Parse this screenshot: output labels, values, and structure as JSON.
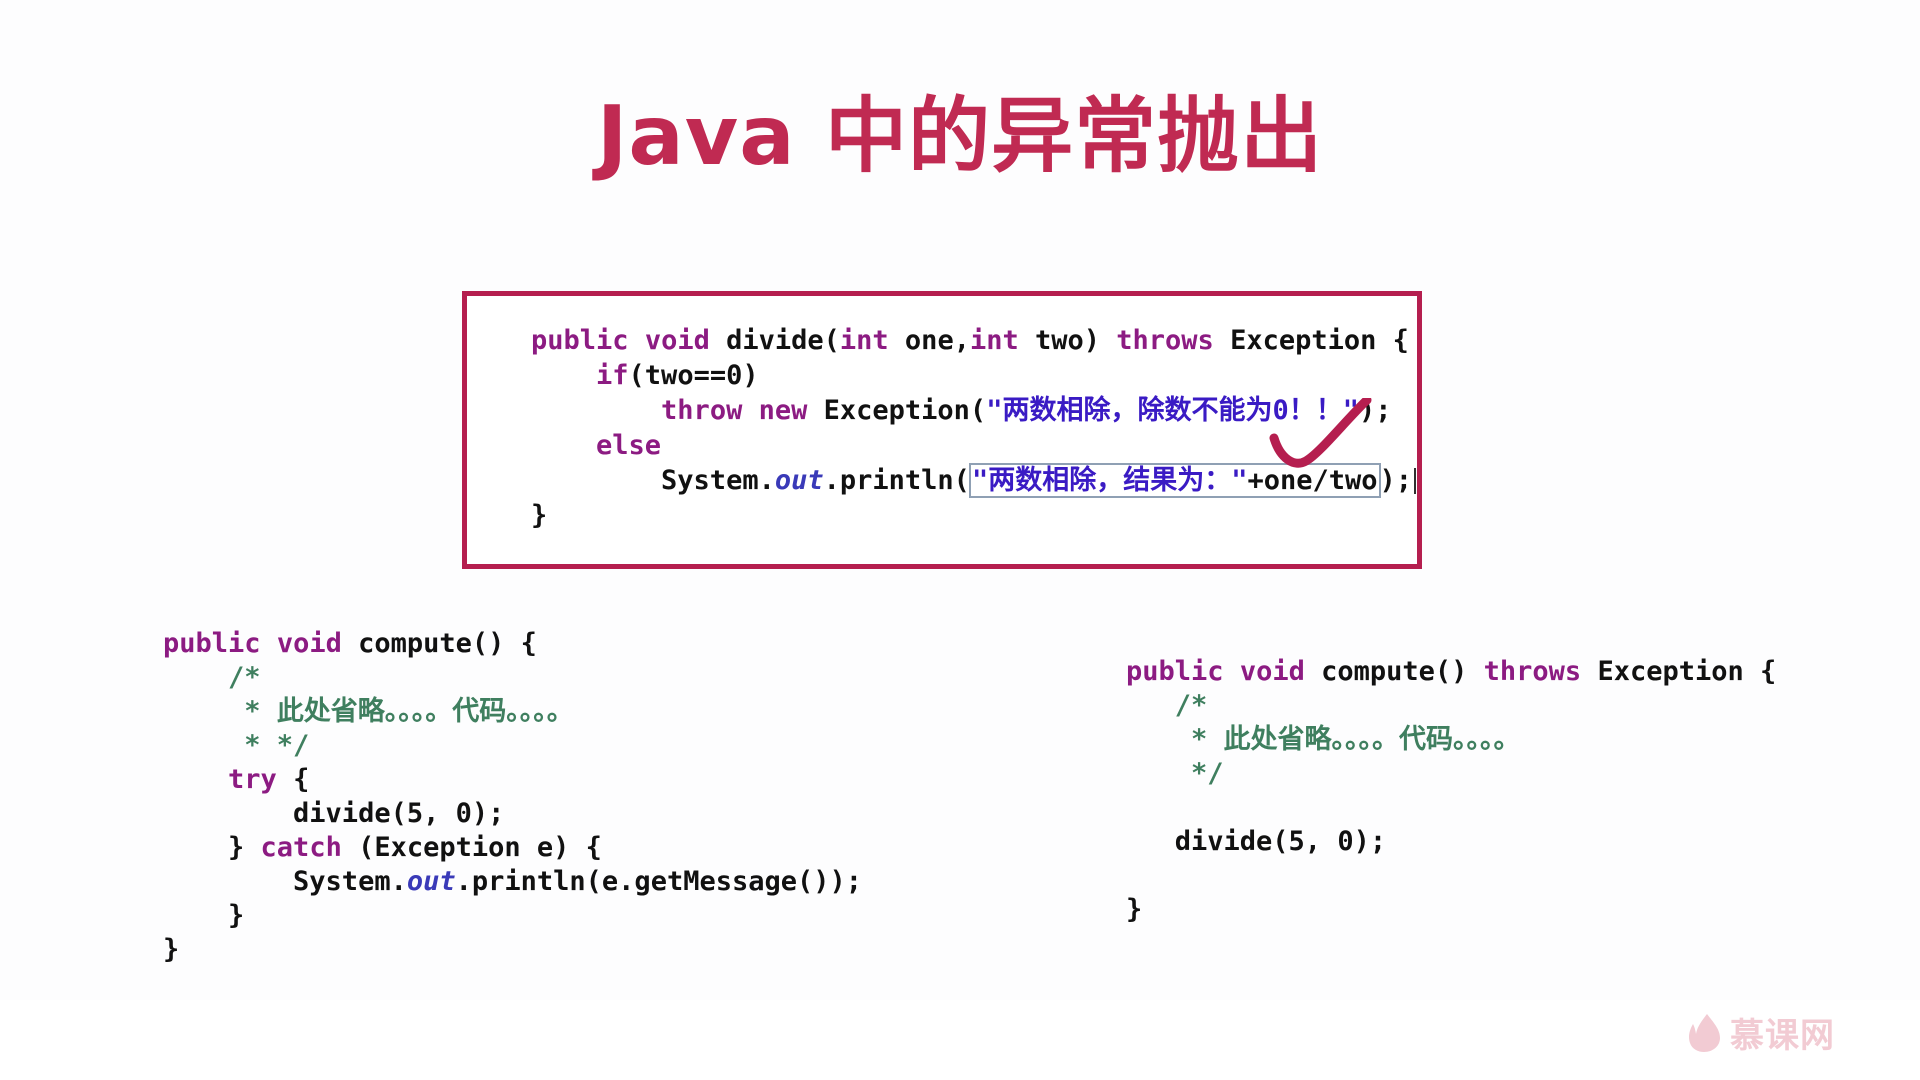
{
  "slide": {
    "title": "Java 中的异常抛出",
    "title_color": "#c02a52",
    "background_color": "#ffffff"
  },
  "code_box": {
    "border_color": "#b51e4f",
    "lines": [
      {
        "id": "method-signature",
        "tokens": [
          {
            "t": "public",
            "c": "kw"
          },
          {
            "t": " ",
            "c": "plain"
          },
          {
            "t": "void",
            "c": "kw"
          },
          {
            "t": " divide(",
            "c": "plain"
          },
          {
            "t": "int",
            "c": "kw"
          },
          {
            "t": " one,",
            "c": "plain"
          },
          {
            "t": "int",
            "c": "kw"
          },
          {
            "t": " two) ",
            "c": "plain"
          },
          {
            "t": "throws",
            "c": "kw"
          },
          {
            "t": " Exception {",
            "c": "plain"
          }
        ]
      },
      {
        "id": "if-statement",
        "tokens": [
          {
            "t": "    ",
            "c": "plain"
          },
          {
            "t": "if",
            "c": "kw"
          },
          {
            "t": "(two==0)",
            "c": "plain"
          }
        ]
      },
      {
        "id": "throw-statement",
        "tokens": [
          {
            "t": "        ",
            "c": "plain"
          },
          {
            "t": "throw",
            "c": "kw"
          },
          {
            "t": " ",
            "c": "plain"
          },
          {
            "t": "new",
            "c": "kw"
          },
          {
            "t": " Exception(",
            "c": "plain"
          },
          {
            "t": "\"两数相除，除数不能为0！！\"",
            "c": "str"
          },
          {
            "t": ");",
            "c": "plain"
          }
        ]
      },
      {
        "id": "else-statement",
        "tokens": [
          {
            "t": "    ",
            "c": "plain"
          },
          {
            "t": "else",
            "c": "kw"
          }
        ]
      },
      {
        "id": "println-statement",
        "prefix": [
          {
            "t": "        System.",
            "c": "plain"
          },
          {
            "t": "out",
            "c": "ital"
          },
          {
            "t": ".println(",
            "c": "plain"
          }
        ],
        "selected": [
          {
            "t": "\"两数相除，结果为：\"",
            "c": "str"
          },
          {
            "t": "+one/two",
            "c": "plain"
          }
        ],
        "suffix": [
          {
            "t": ");",
            "c": "plain"
          }
        ],
        "has_caret": true
      },
      {
        "id": "closing-brace",
        "tokens": [
          {
            "t": "}",
            "c": "plain"
          }
        ]
      }
    ]
  },
  "annotation": {
    "name": "checkmark",
    "color": "#b51e4f"
  },
  "code_left": {
    "lines": [
      {
        "id": "compute-signature",
        "tokens": [
          {
            "t": "public",
            "c": "kw"
          },
          {
            "t": " ",
            "c": "plain"
          },
          {
            "t": "void",
            "c": "kw"
          },
          {
            "t": " compute() {",
            "c": "plain"
          }
        ]
      },
      {
        "id": "comment-open",
        "tokens": [
          {
            "t": "    /*",
            "c": "cmt"
          }
        ]
      },
      {
        "id": "comment-body",
        "tokens": [
          {
            "t": "     * 此处省略。。。。代码。。。。",
            "c": "cmt"
          }
        ]
      },
      {
        "id": "comment-close",
        "tokens": [
          {
            "t": "     * */",
            "c": "cmt"
          }
        ]
      },
      {
        "id": "try-open",
        "tokens": [
          {
            "t": "    ",
            "c": "plain"
          },
          {
            "t": "try",
            "c": "kw"
          },
          {
            "t": " {",
            "c": "plain"
          }
        ]
      },
      {
        "id": "divide-call",
        "tokens": [
          {
            "t": "        divide(5, 0);",
            "c": "plain"
          }
        ]
      },
      {
        "id": "catch-clause",
        "tokens": [
          {
            "t": "    } ",
            "c": "plain"
          },
          {
            "t": "catch",
            "c": "kw"
          },
          {
            "t": " (Exception e) {",
            "c": "plain"
          }
        ]
      },
      {
        "id": "print-message",
        "tokens": [
          {
            "t": "        System.",
            "c": "plain"
          },
          {
            "t": "out",
            "c": "ital"
          },
          {
            "t": ".println(e.getMessage());",
            "c": "plain"
          }
        ]
      },
      {
        "id": "catch-close",
        "tokens": [
          {
            "t": "    }",
            "c": "plain"
          }
        ]
      },
      {
        "id": "method-close",
        "tokens": [
          {
            "t": "}",
            "c": "plain"
          }
        ]
      }
    ]
  },
  "code_right": {
    "lines": [
      {
        "id": "compute-signature-throws",
        "tokens": [
          {
            "t": "public",
            "c": "kw"
          },
          {
            "t": " ",
            "c": "plain"
          },
          {
            "t": "void",
            "c": "kw"
          },
          {
            "t": " compute() ",
            "c": "plain"
          },
          {
            "t": "throws",
            "c": "kw"
          },
          {
            "t": " Exception {",
            "c": "plain"
          }
        ]
      },
      {
        "id": "comment-open",
        "tokens": [
          {
            "t": "   /*",
            "c": "cmt"
          }
        ]
      },
      {
        "id": "comment-body",
        "tokens": [
          {
            "t": "    * 此处省略。。。。代码。。。。",
            "c": "cmt"
          }
        ]
      },
      {
        "id": "comment-close",
        "tokens": [
          {
            "t": "    */",
            "c": "cmt"
          }
        ]
      },
      {
        "id": "blank",
        "tokens": [
          {
            "t": " ",
            "c": "plain"
          }
        ]
      },
      {
        "id": "divide-call",
        "tokens": [
          {
            "t": "   divide(5, 0);",
            "c": "plain"
          }
        ]
      },
      {
        "id": "blank2",
        "tokens": [
          {
            "t": " ",
            "c": "plain"
          }
        ]
      },
      {
        "id": "method-close",
        "tokens": [
          {
            "t": "}",
            "c": "plain"
          }
        ]
      }
    ]
  },
  "watermark": {
    "text": "慕课网",
    "icon": "flame-icon",
    "color": "#f0c2cc"
  }
}
